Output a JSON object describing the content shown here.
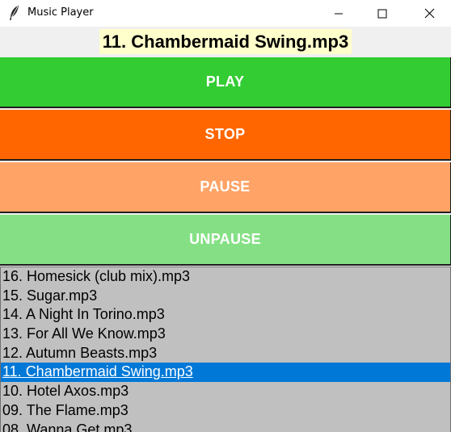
{
  "window": {
    "title": "Music Player",
    "icon": "feather-icon"
  },
  "now_playing": {
    "title": "11. Chambermaid Swing.mp3"
  },
  "controls": [
    {
      "label": "PLAY",
      "color": "#33cc33"
    },
    {
      "label": "STOP",
      "color": "#ff6600"
    },
    {
      "label": "PAUSE",
      "color": "#ffa366"
    },
    {
      "label": "UNPAUSE",
      "color": "#85e085"
    }
  ],
  "playlist": {
    "selected_index": 5,
    "items": [
      "16. Homesick (club mix).mp3",
      "15. Sugar.mp3",
      "14. A Night In Torino.mp3",
      "13. For All We Know.mp3",
      "12. Autumn Beasts.mp3",
      "11. Chambermaid Swing.mp3",
      "10. Hotel Axos.mp3",
      "09. The Flame.mp3",
      "08. Wanna Get.mp3"
    ]
  }
}
